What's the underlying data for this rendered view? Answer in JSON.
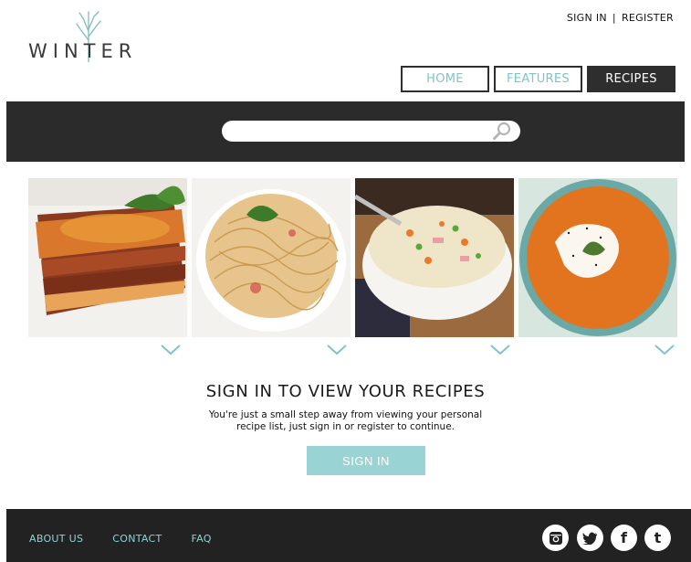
{
  "brand": {
    "logo_text": "WINTER"
  },
  "auth": {
    "sign_in": "SIGN IN",
    "separator": "|",
    "register": "REGISTER"
  },
  "nav": {
    "home": "HOME",
    "features": "FEATURES",
    "recipes": "RECIPES",
    "active": "RECIPES"
  },
  "search": {
    "placeholder": "",
    "value": ""
  },
  "recipes": [
    {
      "name": "lasagna"
    },
    {
      "name": "spaghetti"
    },
    {
      "name": "fried-rice"
    },
    {
      "name": "pumpkin-soup"
    }
  ],
  "signin": {
    "title": "SIGN IN TO VIEW YOUR RECIPES",
    "description": "You're just a small step away from viewing your personal recipe list, just sign in or register to continue.",
    "button": "SIGN IN"
  },
  "footer": {
    "links": [
      "ABOUT US",
      "CONTACT",
      "FAQ"
    ],
    "social": [
      {
        "icon": "instagram-icon"
      },
      {
        "icon": "twitter-icon"
      },
      {
        "icon": "facebook-icon",
        "glyph": "f"
      },
      {
        "icon": "tumblr-icon",
        "glyph": "t"
      }
    ]
  },
  "colors": {
    "accent": "#99d3d3",
    "dark": "#2b2b2b",
    "link": "#8fd3d4"
  }
}
